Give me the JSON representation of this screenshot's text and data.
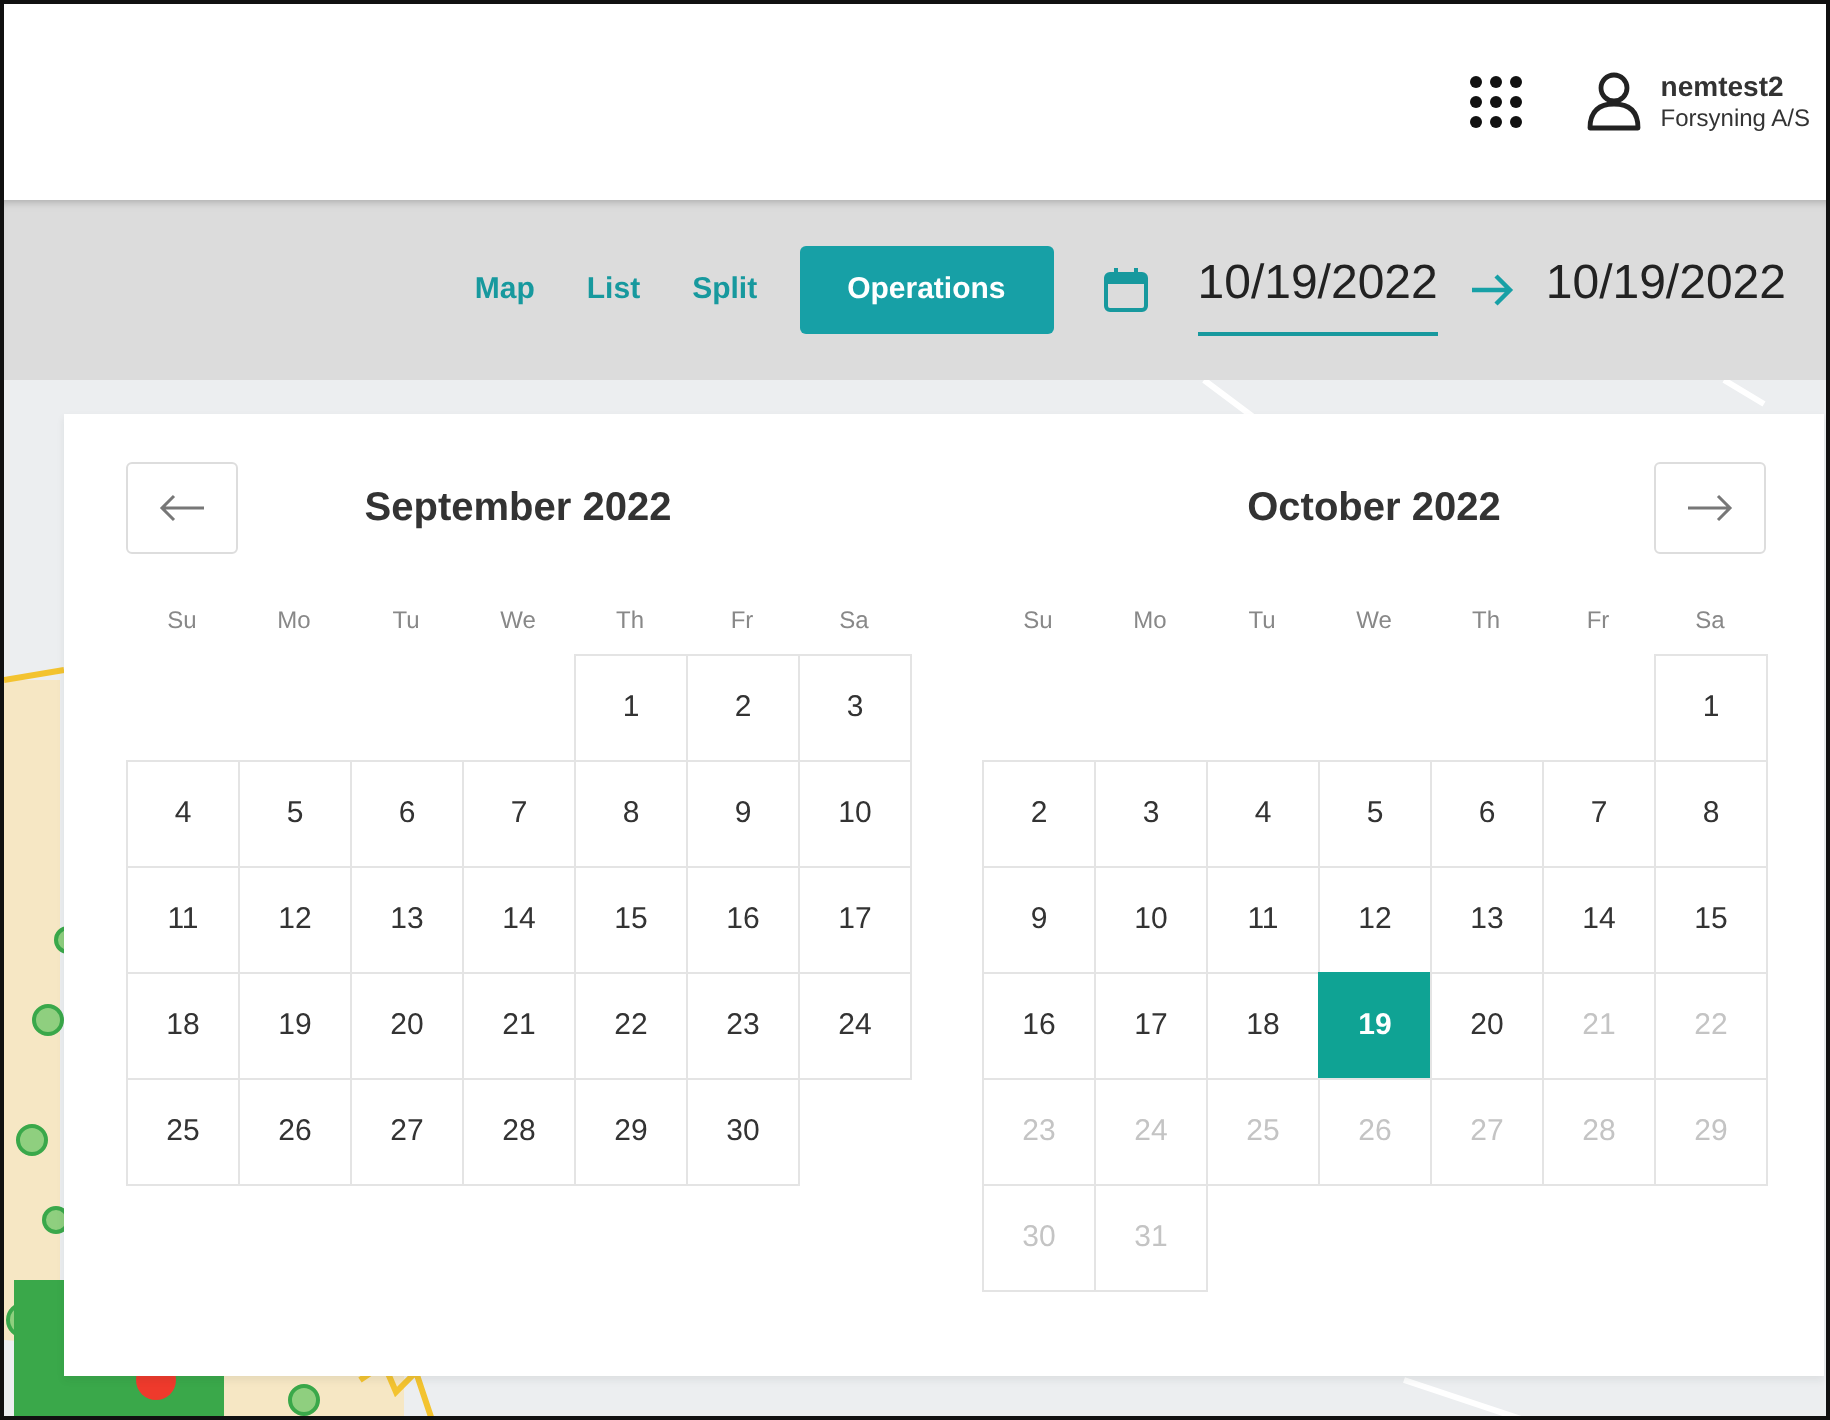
{
  "header": {
    "user": {
      "name": "nemtest2",
      "org": "Forsyning A/S"
    }
  },
  "toolbar": {
    "tabs": [
      {
        "label": "Map",
        "selected": false
      },
      {
        "label": "List",
        "selected": false
      },
      {
        "label": "Split",
        "selected": false
      },
      {
        "label": "Operations",
        "selected": true
      }
    ],
    "date_range": {
      "start": "10/19/2022",
      "end": "10/19/2022",
      "start_active": true
    }
  },
  "calendar": {
    "months": [
      {
        "title": "September 2022",
        "weekdays": [
          "Su",
          "Mo",
          "Tu",
          "We",
          "Th",
          "Fr",
          "Sa"
        ],
        "weeks": [
          [
            {
              "kind": "blank"
            },
            {
              "kind": "blank"
            },
            {
              "kind": "blank"
            },
            {
              "kind": "blank"
            },
            {
              "kind": "day",
              "day": "1",
              "selected": false,
              "disabled": false
            },
            {
              "kind": "day",
              "day": "2",
              "selected": false,
              "disabled": false
            },
            {
              "kind": "day",
              "day": "3",
              "selected": false,
              "disabled": false
            }
          ],
          [
            {
              "kind": "day",
              "day": "4",
              "selected": false,
              "disabled": false
            },
            {
              "kind": "day",
              "day": "5",
              "selected": false,
              "disabled": false
            },
            {
              "kind": "day",
              "day": "6",
              "selected": false,
              "disabled": false
            },
            {
              "kind": "day",
              "day": "7",
              "selected": false,
              "disabled": false
            },
            {
              "kind": "day",
              "day": "8",
              "selected": false,
              "disabled": false
            },
            {
              "kind": "day",
              "day": "9",
              "selected": false,
              "disabled": false
            },
            {
              "kind": "day",
              "day": "10",
              "selected": false,
              "disabled": false
            }
          ],
          [
            {
              "kind": "day",
              "day": "11",
              "selected": false,
              "disabled": false
            },
            {
              "kind": "day",
              "day": "12",
              "selected": false,
              "disabled": false
            },
            {
              "kind": "day",
              "day": "13",
              "selected": false,
              "disabled": false
            },
            {
              "kind": "day",
              "day": "14",
              "selected": false,
              "disabled": false
            },
            {
              "kind": "day",
              "day": "15",
              "selected": false,
              "disabled": false
            },
            {
              "kind": "day",
              "day": "16",
              "selected": false,
              "disabled": false
            },
            {
              "kind": "day",
              "day": "17",
              "selected": false,
              "disabled": false
            }
          ],
          [
            {
              "kind": "day",
              "day": "18",
              "selected": false,
              "disabled": false
            },
            {
              "kind": "day",
              "day": "19",
              "selected": false,
              "disabled": false
            },
            {
              "kind": "day",
              "day": "20",
              "selected": false,
              "disabled": false
            },
            {
              "kind": "day",
              "day": "21",
              "selected": false,
              "disabled": false
            },
            {
              "kind": "day",
              "day": "22",
              "selected": false,
              "disabled": false
            },
            {
              "kind": "day",
              "day": "23",
              "selected": false,
              "disabled": false
            },
            {
              "kind": "day",
              "day": "24",
              "selected": false,
              "disabled": false
            }
          ],
          [
            {
              "kind": "day",
              "day": "25",
              "selected": false,
              "disabled": false
            },
            {
              "kind": "day",
              "day": "26",
              "selected": false,
              "disabled": false
            },
            {
              "kind": "day",
              "day": "27",
              "selected": false,
              "disabled": false
            },
            {
              "kind": "day",
              "day": "28",
              "selected": false,
              "disabled": false
            },
            {
              "kind": "day",
              "day": "29",
              "selected": false,
              "disabled": false
            },
            {
              "kind": "day",
              "day": "30",
              "selected": false,
              "disabled": false
            },
            {
              "kind": "blank"
            }
          ]
        ]
      },
      {
        "title": "October 2022",
        "weekdays": [
          "Su",
          "Mo",
          "Tu",
          "We",
          "Th",
          "Fr",
          "Sa"
        ],
        "weeks": [
          [
            {
              "kind": "blank"
            },
            {
              "kind": "blank"
            },
            {
              "kind": "blank"
            },
            {
              "kind": "blank"
            },
            {
              "kind": "blank"
            },
            {
              "kind": "blank"
            },
            {
              "kind": "day",
              "day": "1",
              "selected": false,
              "disabled": false
            }
          ],
          [
            {
              "kind": "day",
              "day": "2",
              "selected": false,
              "disabled": false
            },
            {
              "kind": "day",
              "day": "3",
              "selected": false,
              "disabled": false
            },
            {
              "kind": "day",
              "day": "4",
              "selected": false,
              "disabled": false
            },
            {
              "kind": "day",
              "day": "5",
              "selected": false,
              "disabled": false
            },
            {
              "kind": "day",
              "day": "6",
              "selected": false,
              "disabled": false
            },
            {
              "kind": "day",
              "day": "7",
              "selected": false,
              "disabled": false
            },
            {
              "kind": "day",
              "day": "8",
              "selected": false,
              "disabled": false
            }
          ],
          [
            {
              "kind": "day",
              "day": "9",
              "selected": false,
              "disabled": false
            },
            {
              "kind": "day",
              "day": "10",
              "selected": false,
              "disabled": false
            },
            {
              "kind": "day",
              "day": "11",
              "selected": false,
              "disabled": false
            },
            {
              "kind": "day",
              "day": "12",
              "selected": false,
              "disabled": false
            },
            {
              "kind": "day",
              "day": "13",
              "selected": false,
              "disabled": false
            },
            {
              "kind": "day",
              "day": "14",
              "selected": false,
              "disabled": false
            },
            {
              "kind": "day",
              "day": "15",
              "selected": false,
              "disabled": false
            }
          ],
          [
            {
              "kind": "day",
              "day": "16",
              "selected": false,
              "disabled": false
            },
            {
              "kind": "day",
              "day": "17",
              "selected": false,
              "disabled": false
            },
            {
              "kind": "day",
              "day": "18",
              "selected": false,
              "disabled": false
            },
            {
              "kind": "day",
              "day": "19",
              "selected": true,
              "disabled": false
            },
            {
              "kind": "day",
              "day": "20",
              "selected": false,
              "disabled": false
            },
            {
              "kind": "day",
              "day": "21",
              "selected": false,
              "disabled": true
            },
            {
              "kind": "day",
              "day": "22",
              "selected": false,
              "disabled": true
            }
          ],
          [
            {
              "kind": "day",
              "day": "23",
              "selected": false,
              "disabled": true
            },
            {
              "kind": "day",
              "day": "24",
              "selected": false,
              "disabled": true
            },
            {
              "kind": "day",
              "day": "25",
              "selected": false,
              "disabled": true
            },
            {
              "kind": "day",
              "day": "26",
              "selected": false,
              "disabled": true
            },
            {
              "kind": "day",
              "day": "27",
              "selected": false,
              "disabled": true
            },
            {
              "kind": "day",
              "day": "28",
              "selected": false,
              "disabled": true
            },
            {
              "kind": "day",
              "day": "29",
              "selected": false,
              "disabled": true
            }
          ],
          [
            {
              "kind": "day",
              "day": "30",
              "selected": false,
              "disabled": true
            },
            {
              "kind": "day",
              "day": "31",
              "selected": false,
              "disabled": true
            },
            {
              "kind": "blank"
            },
            {
              "kind": "blank"
            },
            {
              "kind": "blank"
            },
            {
              "kind": "blank"
            },
            {
              "kind": "blank"
            }
          ]
        ]
      }
    ]
  }
}
